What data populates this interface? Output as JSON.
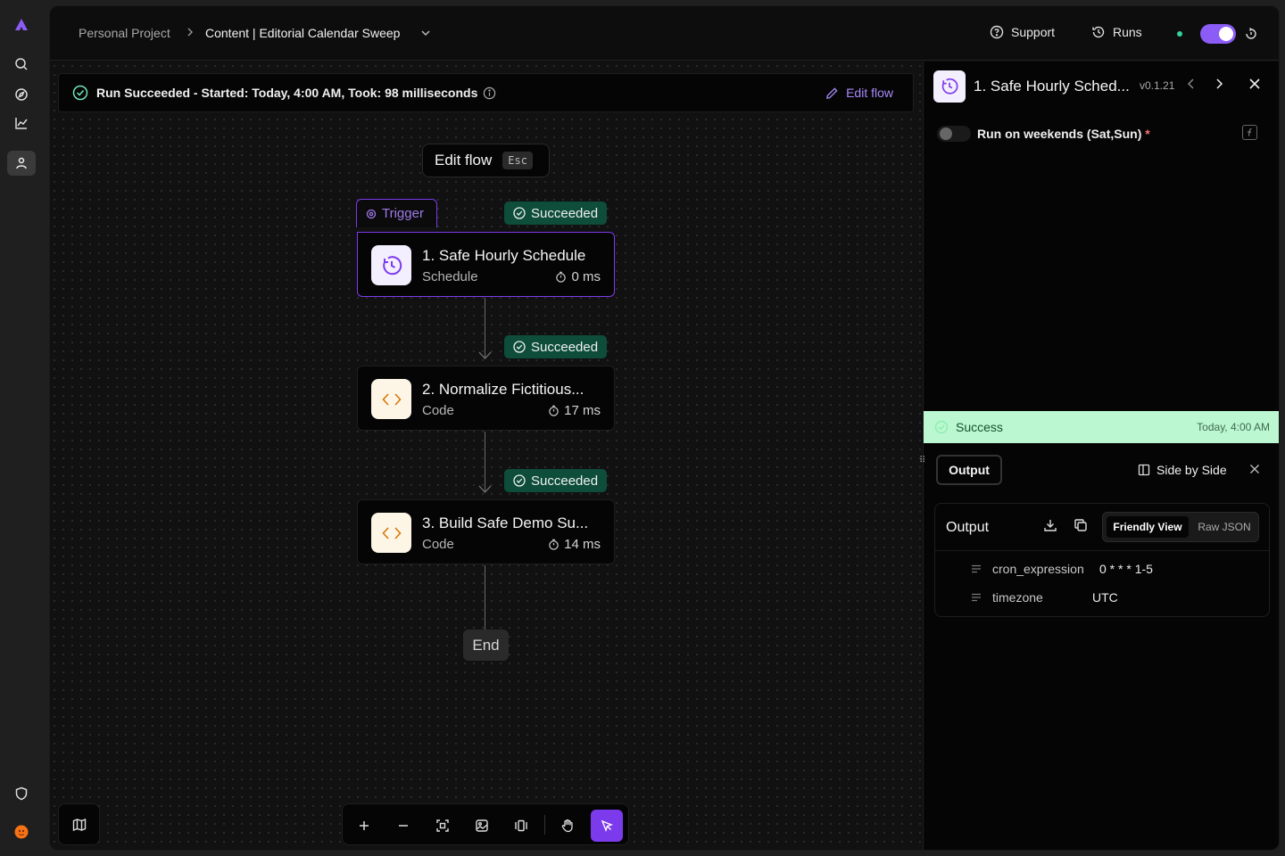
{
  "rail": {
    "icons": [
      "logo-icon",
      "search-icon",
      "compass-icon",
      "chart-icon",
      "user-icon",
      "shield-icon",
      "avatar"
    ]
  },
  "header": {
    "breadcrumb_project": "Personal Project",
    "breadcrumb_separator": ">",
    "breadcrumb_flow": "Content | Editorial Calendar Sweep",
    "support_label": "Support",
    "runs_label": "Runs",
    "flow_enabled": true
  },
  "run_status": {
    "text": "Run Succeeded - Started: Today, 4:00 AM, Took: 98 milliseconds",
    "edit_flow_label": "Edit flow"
  },
  "canvas": {
    "edit_pill_label": "Edit flow",
    "edit_pill_kbd": "Esc",
    "trigger_label": "Trigger",
    "end_label": "End",
    "steps": [
      {
        "status": "Succeeded",
        "title": "1. Safe Hourly Schedule",
        "type": "Schedule",
        "duration": "0 ms",
        "icon": "clock-icon"
      },
      {
        "status": "Succeeded",
        "title": "2. Normalize Fictitious...",
        "type": "Code",
        "duration": "17 ms",
        "icon": "code-icon"
      },
      {
        "status": "Succeeded",
        "title": "3. Build Safe Demo Su...",
        "type": "Code",
        "duration": "14 ms",
        "icon": "code-icon"
      }
    ]
  },
  "toolbar": {
    "tools": [
      "plus-icon",
      "minus-icon",
      "fit-view-icon",
      "image-export-icon",
      "layout-icon",
      "hand-icon",
      "pointer-icon"
    ],
    "active_tool": "pointer-icon"
  },
  "panel": {
    "title": "1. Safe Hourly Sched...",
    "version": "v0.1.21",
    "weekend_label": "Run on weekends (Sat,Sun)",
    "weekend_required": "*",
    "weekend_enabled": false,
    "success_label": "Success",
    "success_time": "Today, 4:00 AM",
    "output_tab": "Output",
    "side_by_side": "Side by Side",
    "output_heading": "Output",
    "friendly_view": "Friendly View",
    "raw_json": "Raw JSON",
    "fields": [
      {
        "key": "cron_expression",
        "value": "0 * * * 1-5"
      },
      {
        "key": "timezone",
        "value": "UTC"
      }
    ]
  },
  "colors": {
    "accent": "#7c3aed",
    "success_bg": "#bbf7d0",
    "badge_bg": "#0d4d3a",
    "badge_fg": "#6ee7b7"
  }
}
